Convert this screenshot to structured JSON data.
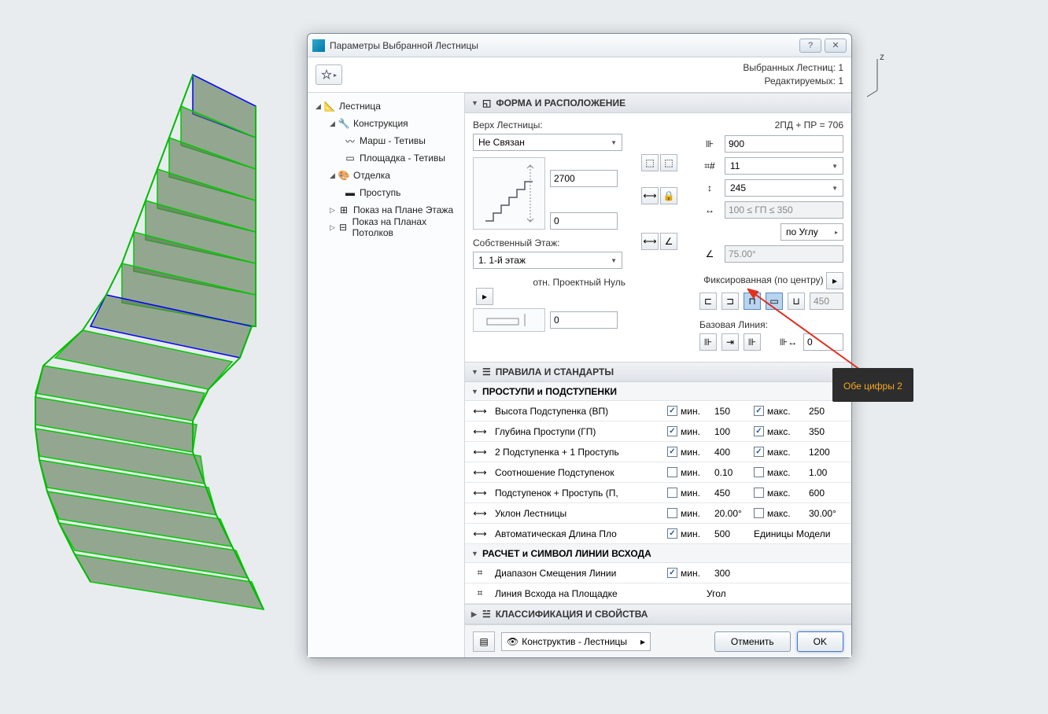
{
  "dialog": {
    "title": "Параметры Выбранной Лестницы",
    "selected_count_label": "Выбранных Лестниц: 1",
    "editable_count_label": "Редактируемых: 1"
  },
  "tree": {
    "root": "Лестница",
    "construction": "Конструкция",
    "march": "Марш - Тетивы",
    "landing": "Площадка - Тетивы",
    "finish": "Отделка",
    "tread": "Проступь",
    "floor_plan": "Показ на Плане Этажа",
    "ceiling_plan": "Показ на Планах Потолков"
  },
  "sections": {
    "form": "ФОРМА И РАСПОЛОЖЕНИЕ",
    "rules": "ПРАВИЛА И СТАНДАРТЫ",
    "classification": "КЛАССИФИКАЦИЯ И СВОЙСТВА"
  },
  "form": {
    "top_label": "Верх Лестницы:",
    "top_value": "Не Связан",
    "formula": "2ПД + ПР = 706",
    "width_val": "900",
    "steps_val": "11",
    "riser_val": "245",
    "height_val": "2700",
    "base_val": "0",
    "going_range": "100 ≤ ГП ≤ 350",
    "angle_mode": "по Углу",
    "angle_val": "75.00°",
    "own_story_label": "Собственный Этаж:",
    "own_story_val": "1. 1-й этаж",
    "fixed_label": "Фиксированная (по центру)",
    "fixed_val": "450",
    "baseline_label": "Базовая Линия:",
    "baseline_val": "0",
    "ref_label": "отн. Проектный Нуль",
    "ref_val": "0"
  },
  "rules": {
    "sub1": "ПРОСТУПИ и ПОДСТУПЕНКИ",
    "sub2": "РАСЧЕТ и СИМВОЛ ЛИНИИ ВСХОДА",
    "min_label": "мин.",
    "max_label": "макс.",
    "rows": [
      {
        "name": "Высота Подступенка (ВП)",
        "min_on": true,
        "min": "150",
        "max_on": true,
        "max": "250"
      },
      {
        "name": "Глубина Проступи (ГП)",
        "min_on": true,
        "min": "100",
        "max_on": true,
        "max": "350"
      },
      {
        "name": "2 Подступенка + 1 Проступь",
        "min_on": true,
        "min": "400",
        "max_on": true,
        "max": "1200"
      },
      {
        "name": "Соотношение Подступенок",
        "min_on": false,
        "min": "0.10",
        "max_on": false,
        "max": "1.00"
      },
      {
        "name": "Подступенок + Проступь (П,",
        "min_on": false,
        "min": "450",
        "max_on": false,
        "max": "600"
      },
      {
        "name": "Уклон Лестницы",
        "min_on": false,
        "min": "20.00°",
        "max_on": false,
        "max": "30.00°"
      },
      {
        "name": "Автоматическая Длина Пло",
        "min_on": true,
        "min": "500",
        "max_label": "Единицы Модели",
        "max": ""
      }
    ],
    "rows2": [
      {
        "name": "Диапазон Смещения Линии",
        "min_on": true,
        "min": "300"
      },
      {
        "name": "Линия Всхода на Площадке",
        "val": "Угол"
      }
    ]
  },
  "buttons": {
    "layer": "Конструктив - Лестницы",
    "cancel": "Отменить",
    "ok": "OK"
  },
  "annotation": "Обе цифры 2",
  "axis": "z"
}
